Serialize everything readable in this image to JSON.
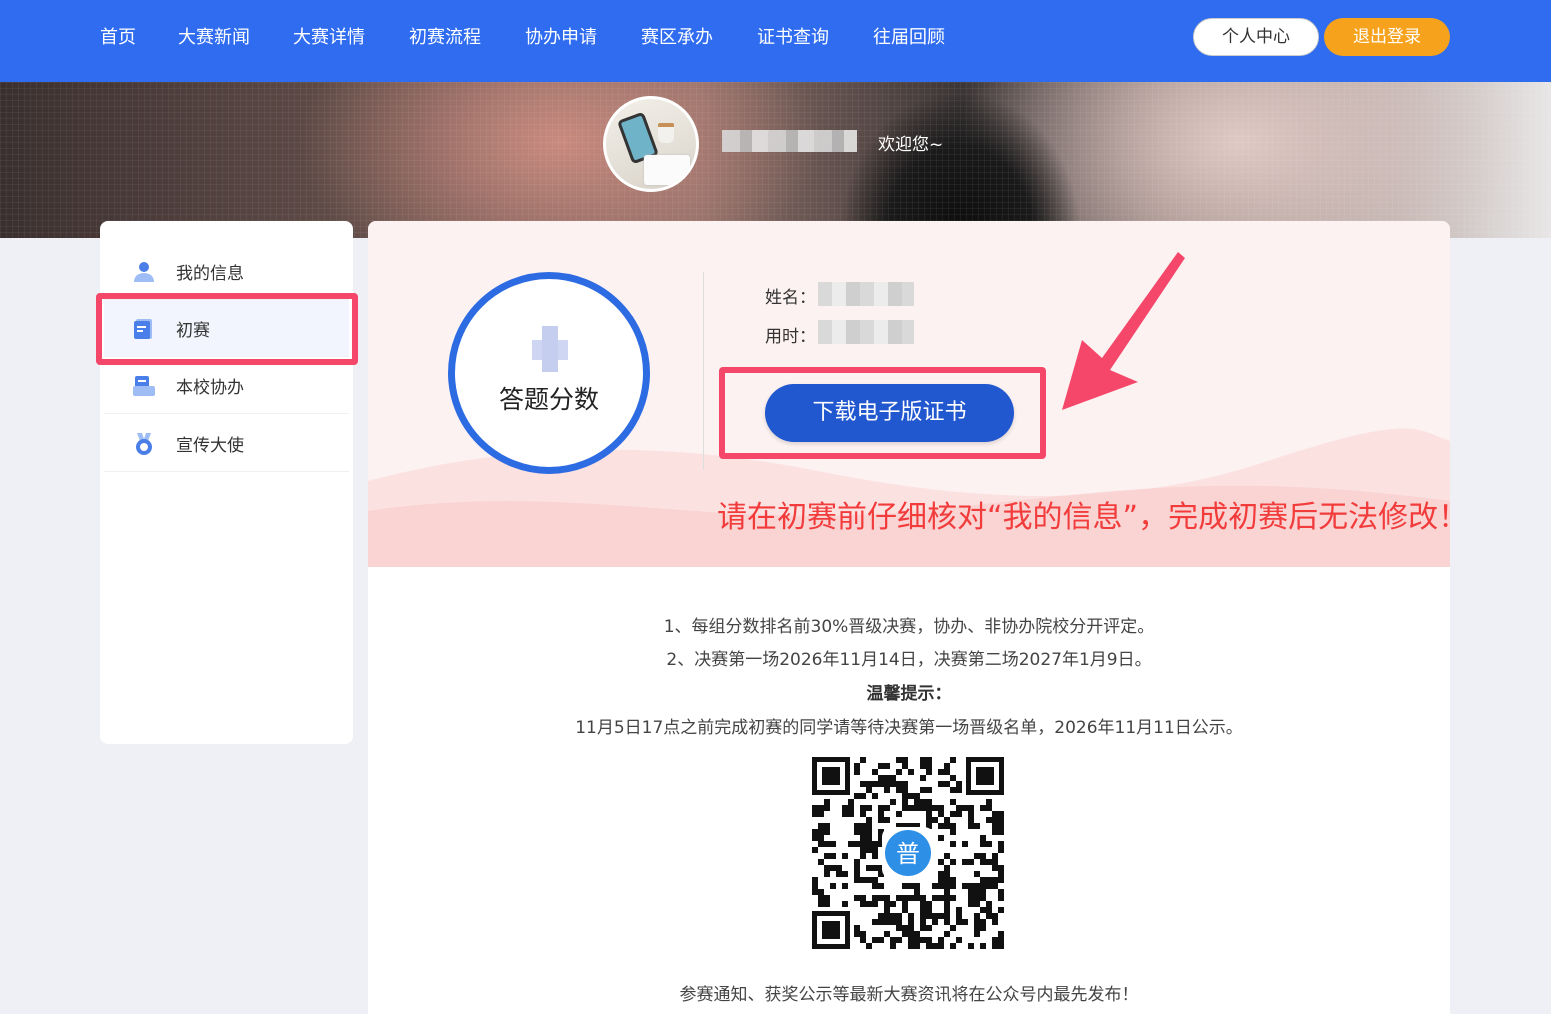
{
  "nav": {
    "items": [
      "首页",
      "大赛新闻",
      "大赛详情",
      "初赛流程",
      "协办申请",
      "赛区承办",
      "证书查询",
      "往届回顾"
    ],
    "personal_center": "个人中心",
    "logout": "退出登录"
  },
  "banner": {
    "welcome": "欢迎您~"
  },
  "sidebar": {
    "items": [
      {
        "label": "我的信息",
        "icon": "user-icon"
      },
      {
        "label": "初赛",
        "icon": "document-icon"
      },
      {
        "label": "本校协办",
        "icon": "school-icon"
      },
      {
        "label": "宣传大使",
        "icon": "medal-icon"
      }
    ],
    "active": "初赛"
  },
  "result": {
    "score_label": "答题分数",
    "name_label": "姓名：",
    "time_label": "用时：",
    "download_button": "下载电子版证书"
  },
  "warning": "请在初赛前仔细核对“我的信息”，完成初赛后无法修改！",
  "notice": {
    "line1": "1、每组分数排名前30%晋级决赛，协办、非协办院校分开评定。",
    "line2": "2、决赛第一场2026年11月14日，决赛第二场2027年1月9日。",
    "tip_title": "温馨提示：",
    "tip": "11月5日17点之前完成初赛的同学请等待决赛第一场晋级名单，2026年11月11日公示。",
    "qr_logo": "普",
    "footer": "参赛通知、获奖公示等最新大赛资讯将在公众号内最先发布！"
  },
  "colors": {
    "nav_bg": "#2f6cf0",
    "logout_bg": "#f7a21c",
    "button_blue": "#2157cf",
    "highlight_red": "#f4476a",
    "warning_red": "#f23c3c"
  }
}
